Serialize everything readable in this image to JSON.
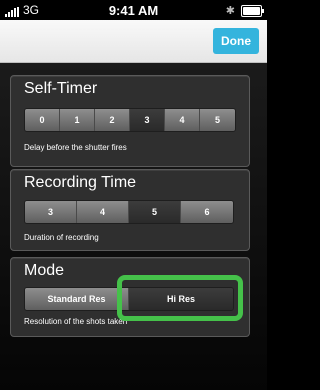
{
  "status_bar": {
    "carrier": "3G",
    "time": "9:41 AM"
  },
  "navbar": {
    "done_label": "Done"
  },
  "self_timer": {
    "title": "Self-Timer",
    "options": [
      "0",
      "1",
      "2",
      "3",
      "4",
      "5"
    ],
    "selected": "3",
    "description": "Delay before the shutter fires"
  },
  "recording_time": {
    "title": "Recording Time",
    "options": [
      "3",
      "4",
      "5",
      "6"
    ],
    "selected": "5",
    "description": "Duration of recording"
  },
  "mode": {
    "title": "Mode",
    "options": [
      "Standard Res",
      "Hi Res"
    ],
    "selected": "Hi Res",
    "description": "Resolution of the shots taken"
  },
  "colors": {
    "accent": "#34b4dd",
    "highlight": "#45c14a",
    "panel": "#2f2f2f"
  }
}
